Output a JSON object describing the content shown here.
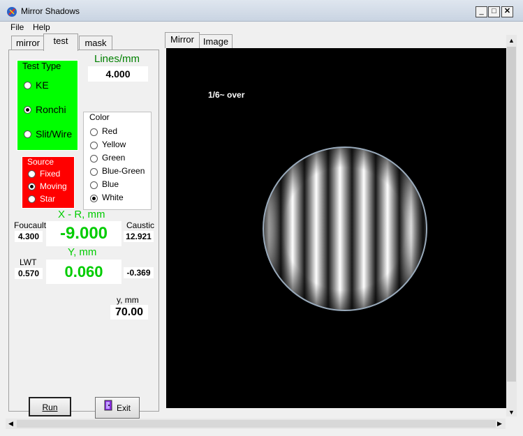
{
  "window": {
    "title": "Mirror Shadows"
  },
  "menu": {
    "file": "File",
    "help": "Help"
  },
  "left_tabs": [
    "mirror",
    "test",
    "mask"
  ],
  "test": {
    "lines_label": "Lines/mm",
    "lines_value": "4.000",
    "test_type_legend": "Test Type",
    "test_types": [
      "KE",
      "Ronchi",
      "Slit/Wire"
    ],
    "source_legend": "Source",
    "sources": [
      "Fixed",
      "Moving",
      "Star"
    ],
    "color_legend": "Color",
    "colors": [
      "Red",
      "Yellow",
      "Green",
      "Blue-Green",
      "Blue",
      "White"
    ],
    "xr_label": "X - R, mm",
    "xr_value": "-9.000",
    "foucault_label": "Foucault",
    "foucault_value": "4.300",
    "caustic_label": "Caustic",
    "caustic_value": "12.921",
    "y_label": "Y, mm",
    "y_value": "0.060",
    "lwt_label": "LWT",
    "lwt_value": "0.570",
    "y_right_value": "-0.369",
    "ymm_label": "y, mm",
    "ymm_value": "70.00"
  },
  "buttons": {
    "run": "Run",
    "exit": "Exit"
  },
  "right_tabs": [
    "Mirror",
    "Image"
  ],
  "view": {
    "overlay_text": "1/6~ over"
  },
  "colors": {
    "test_type_bg": "#00ff00",
    "source_bg": "#ff0000",
    "green_text": "#00cc00",
    "title_green": "#008000"
  }
}
